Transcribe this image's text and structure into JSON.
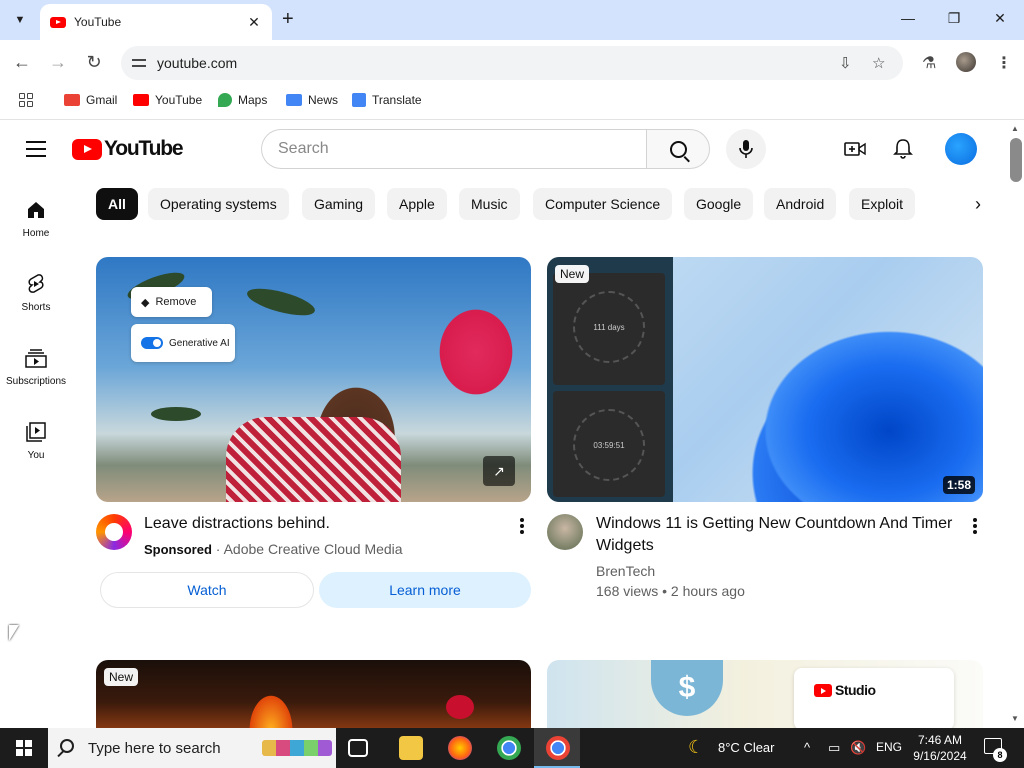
{
  "browser": {
    "tab_title": "YouTube",
    "url": "youtube.com",
    "bookmarks": [
      {
        "label": "Gmail",
        "color": "#ea4335"
      },
      {
        "label": "YouTube",
        "color": "#ff0000"
      },
      {
        "label": "Maps",
        "color": "#34a853"
      },
      {
        "label": "News",
        "color": "#4285f4"
      },
      {
        "label": "Translate",
        "color": "#4285f4"
      }
    ]
  },
  "youtube": {
    "logo_text": "YouTube",
    "search_placeholder": "Search",
    "sidebar": [
      {
        "label": "Home",
        "icon": "home-icon"
      },
      {
        "label": "Shorts",
        "icon": "shorts-icon"
      },
      {
        "label": "Subscriptions",
        "icon": "subscriptions-icon"
      },
      {
        "label": "You",
        "icon": "you-icon"
      }
    ],
    "chips": [
      "All",
      "Operating systems",
      "Gaming",
      "Apple",
      "Music",
      "Computer Science",
      "Google",
      "Android",
      "Exploit"
    ],
    "ad": {
      "title": "Leave distractions behind.",
      "sponsored": "Sponsored",
      "advertiser": "Adobe Creative Cloud Media",
      "watch_label": "Watch",
      "learn_label": "Learn more",
      "overlay_remove": "Remove",
      "overlay_generative": "Generative AI"
    },
    "video": {
      "title": "Windows 11 is Getting New Countdown And Timer Widgets",
      "channel": "BrenTech",
      "stats": "168 views • 2 hours ago",
      "duration": "1:58",
      "badge": "New",
      "widget_days": "111 days",
      "widget_timer": "03:59:51"
    },
    "row2": {
      "badge": "New",
      "studio_text": "Studio",
      "dollar": "$"
    }
  },
  "taskbar": {
    "search_placeholder": "Type here to search",
    "weather": "8°C  Clear",
    "language": "ENG",
    "time": "7:46 AM",
    "date": "9/16/2024",
    "notifications": "8"
  },
  "colors": {
    "accent_blue": "#065fd4",
    "youtube_red": "#ff0000",
    "chrome_tab_strip": "#d3e3fd"
  }
}
